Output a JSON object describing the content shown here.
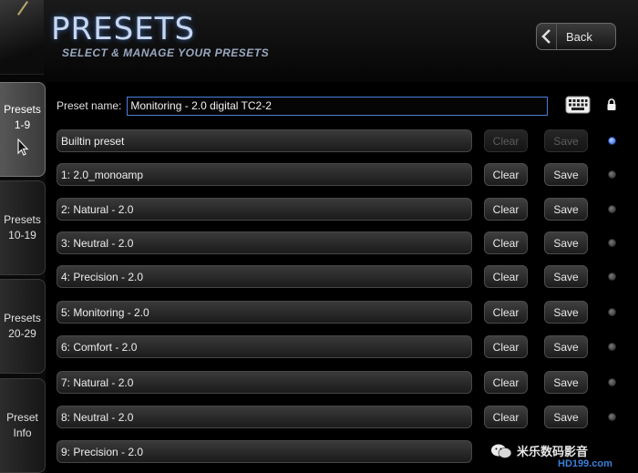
{
  "header": {
    "title": "PRESETS",
    "subtitle": "SELECT & MANAGE YOUR PRESETS",
    "back_label": "Back"
  },
  "sidebar": {
    "tabs": [
      {
        "line1": "Presets",
        "line2": "1-9",
        "active": true
      },
      {
        "line1": "Presets",
        "line2": "10-19",
        "active": false
      },
      {
        "line1": "Presets",
        "line2": "20-29",
        "active": false
      },
      {
        "line1": "Preset",
        "line2": "Info",
        "active": false
      }
    ]
  },
  "preset_name": {
    "label": "Preset name:",
    "value": "Monitoring - 2.0 digital TC2-2"
  },
  "buttons": {
    "clear": "Clear",
    "save": "Save"
  },
  "presets": [
    {
      "name": "Builtin preset",
      "enabled": false,
      "active": true
    },
    {
      "name": "1: 2.0_monoamp",
      "enabled": true,
      "active": false
    },
    {
      "name": "2: Natural - 2.0",
      "enabled": true,
      "active": false
    },
    {
      "name": "3: Neutral - 2.0",
      "enabled": true,
      "active": false
    },
    {
      "name": "4: Precision - 2.0",
      "enabled": true,
      "active": false
    },
    {
      "name": "5: Monitoring - 2.0",
      "enabled": true,
      "active": false
    },
    {
      "name": "6: Comfort - 2.0",
      "enabled": true,
      "active": false
    },
    {
      "name": "7: Natural - 2.0",
      "enabled": true,
      "active": false
    },
    {
      "name": "8: Neutral - 2.0",
      "enabled": true,
      "active": false
    },
    {
      "name": "9: Precision - 2.0",
      "enabled": true,
      "active": false
    }
  ],
  "watermark": {
    "text": "米乐数码影音",
    "sub": "HD199.com"
  },
  "colors": {
    "accent": "#4a7fd6",
    "active_dot": "#2e63d9",
    "title_glow": "#3a6ab4"
  },
  "icons": {
    "back": "chevron-left-icon",
    "keyboard": "keyboard-icon",
    "lock": "lock-icon",
    "cursor": "mouse-cursor-icon",
    "wechat": "wechat-icon"
  }
}
